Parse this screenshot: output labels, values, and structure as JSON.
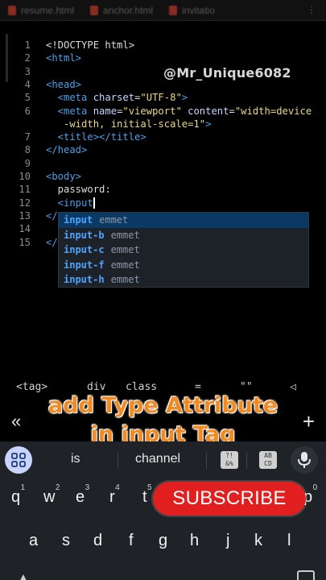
{
  "tabs": [
    {
      "label": "resume.html"
    },
    {
      "label": "anchor.html"
    },
    {
      "label": "invitatio"
    }
  ],
  "tab_more": "⋮",
  "watermark": "@Mr_Unique6082",
  "editor": {
    "lines": [
      {
        "n": "1",
        "tokens": [
          {
            "t": "<!DOCTYPE html>",
            "c": "txt"
          }
        ]
      },
      {
        "n": "2",
        "tokens": [
          {
            "t": "<html>",
            "c": "tag"
          }
        ]
      },
      {
        "n": "3",
        "tokens": []
      },
      {
        "n": "4",
        "tokens": [
          {
            "t": "<head>",
            "c": "tag"
          }
        ]
      },
      {
        "n": "5",
        "tokens": [
          {
            "t": "  <meta ",
            "c": "tag"
          },
          {
            "t": "charset",
            "c": "attr"
          },
          {
            "t": "=",
            "c": "txt"
          },
          {
            "t": "\"UTF-8\"",
            "c": "str"
          },
          {
            "t": ">",
            "c": "tag"
          }
        ]
      },
      {
        "n": "6",
        "tokens": [
          {
            "t": "  <meta ",
            "c": "tag"
          },
          {
            "t": "name",
            "c": "attr"
          },
          {
            "t": "=",
            "c": "txt"
          },
          {
            "t": "\"viewport\"",
            "c": "str"
          },
          {
            "t": " content",
            "c": "attr"
          },
          {
            "t": "=",
            "c": "txt"
          },
          {
            "t": "\"width=device",
            "c": "str"
          }
        ]
      },
      {
        "n": "",
        "tokens": [
          {
            "t": "   -width, initial-scale=1\"",
            "c": "str"
          },
          {
            "t": ">",
            "c": "tag"
          }
        ]
      },
      {
        "n": "7",
        "tokens": [
          {
            "t": "  <title></title>",
            "c": "tag"
          }
        ]
      },
      {
        "n": "8",
        "tokens": [
          {
            "t": "</head>",
            "c": "tag"
          }
        ]
      },
      {
        "n": "9",
        "tokens": []
      },
      {
        "n": "10",
        "tokens": [
          {
            "t": "<body>",
            "c": "tag"
          }
        ]
      },
      {
        "n": "11",
        "tokens": [
          {
            "t": "  password:",
            "c": "txt"
          }
        ]
      },
      {
        "n": "12",
        "tokens": [
          {
            "t": "  <input",
            "c": "tag"
          }
        ],
        "cursor": true
      },
      {
        "n": "13",
        "tokens": [
          {
            "t": "</",
            "c": "tag"
          }
        ]
      },
      {
        "n": "14",
        "tokens": []
      },
      {
        "n": "15",
        "tokens": [
          {
            "t": "</",
            "c": "tag"
          }
        ]
      }
    ]
  },
  "autocomplete": {
    "items": [
      {
        "keyword": "input",
        "kind": "emmet",
        "selected": true
      },
      {
        "keyword": "input-b",
        "kind": "emmet",
        "selected": false
      },
      {
        "keyword": "input-c",
        "kind": "emmet",
        "selected": false
      },
      {
        "keyword": "input-f",
        "kind": "emmet",
        "selected": false
      },
      {
        "keyword": "input-h",
        "kind": "emmet",
        "selected": false
      }
    ]
  },
  "symbols": [
    "<tag>",
    "div",
    "class",
    "=",
    "\"\"",
    "◁"
  ],
  "caption": {
    "line1": "add Type Attribute",
    "line2": "in input Tag"
  },
  "nav": {
    "left": "«",
    "plus": "+"
  },
  "keyboard": {
    "suggestions": [
      "is",
      "channel"
    ],
    "emoji_box_1": "?!\n&%",
    "emoji_box_2": "AB\nCD",
    "row1": [
      {
        "k": "q",
        "s": "1"
      },
      {
        "k": "w",
        "s": "2"
      },
      {
        "k": "e",
        "s": "3"
      },
      {
        "k": "r",
        "s": "4"
      },
      {
        "k": "t",
        "s": "5"
      },
      {
        "k": "p",
        "s": "0"
      }
    ],
    "row2": [
      "a",
      "s",
      "d",
      "f",
      "g",
      "h",
      "j",
      "k",
      "l"
    ]
  },
  "subscribe_label": "SUBSCRIBE",
  "colors": {
    "tag": "#4f9fe6",
    "attr": "#c8d4ff",
    "string": "#e7d88a",
    "caption": "#f28a22",
    "subscribe": "#e11f1f",
    "selection": "#0a3a63"
  }
}
